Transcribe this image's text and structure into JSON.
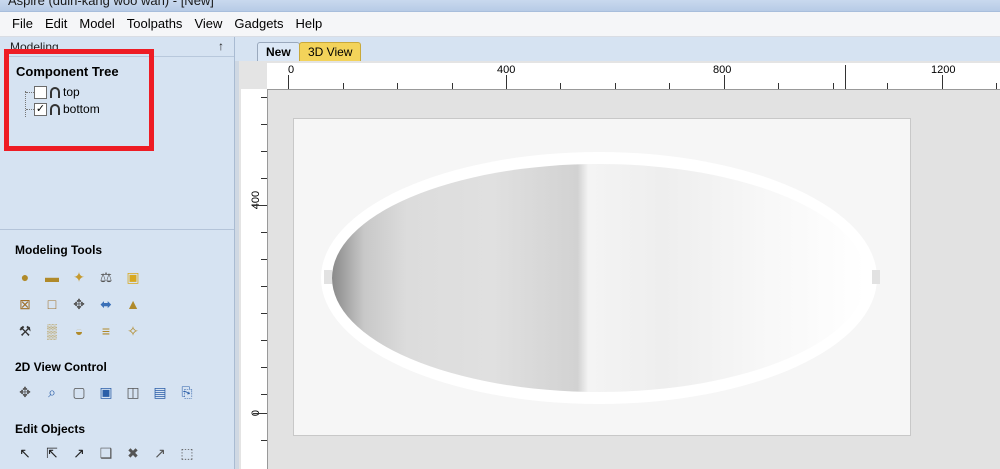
{
  "window": {
    "title": "Aspire (duin-kang woo wan) - [New]"
  },
  "menu": [
    "File",
    "Edit",
    "Model",
    "Toolpaths",
    "View",
    "Gadgets",
    "Help"
  ],
  "panel": {
    "header": "Modeling",
    "pin_glyph": "↑",
    "component_tree": {
      "title": "Component Tree",
      "items": [
        {
          "label": "top",
          "checked": false
        },
        {
          "label": "bottom",
          "checked": true
        }
      ]
    },
    "modeling_tools": {
      "title": "Modeling Tools",
      "rows": [
        [
          "sphere-icon",
          "disc-icon",
          "sculpt-icon",
          "move-icon",
          "folder-icon"
        ],
        [
          "box-icon",
          "square-icon",
          "merge-icon",
          "flip-icon",
          "peak-icon"
        ],
        [
          "wand-icon",
          "texture-icon",
          "dome-icon",
          "stack-icon",
          "sharp-icon"
        ]
      ],
      "glyphs": [
        [
          "●",
          "▬",
          "✦",
          "⚖",
          "▣"
        ],
        [
          "⊠",
          "□",
          "✥",
          "⬌",
          "▲"
        ],
        [
          "⚒",
          "▒",
          "◒",
          "≡",
          "✧"
        ]
      ]
    },
    "view_control": {
      "title": "2D View Control",
      "icons": [
        "pan-icon",
        "zoom-icon",
        "zoom-fit-icon",
        "zoom-box-icon",
        "split-view-icon",
        "align-view-icon",
        "exit-view-icon"
      ],
      "glyphs": [
        "✥",
        "⌕",
        "▢",
        "▣",
        "◫",
        "▤",
        "⎘"
      ]
    },
    "edit_objects": {
      "title": "Edit Objects",
      "icons": [
        "select-icon",
        "node-edit-icon",
        "transform-icon",
        "group-icon",
        "ungroup-icon",
        "measure-icon",
        "distort-icon"
      ],
      "glyphs": [
        "↖",
        "⇱",
        "↗",
        "❑",
        "✖",
        "↗",
        "⬚"
      ]
    }
  },
  "tabs": [
    {
      "label": "New",
      "active": true
    },
    {
      "label": "3D View",
      "active": false
    }
  ],
  "rulers": {
    "top_labels": [
      "0",
      "400",
      "800",
      "1200"
    ],
    "left_labels": [
      "400",
      "0"
    ]
  },
  "colors": {
    "highlight": "#ee1c24",
    "panel_bg": "#d6e3f2",
    "active_tab": "#f3d35a"
  }
}
